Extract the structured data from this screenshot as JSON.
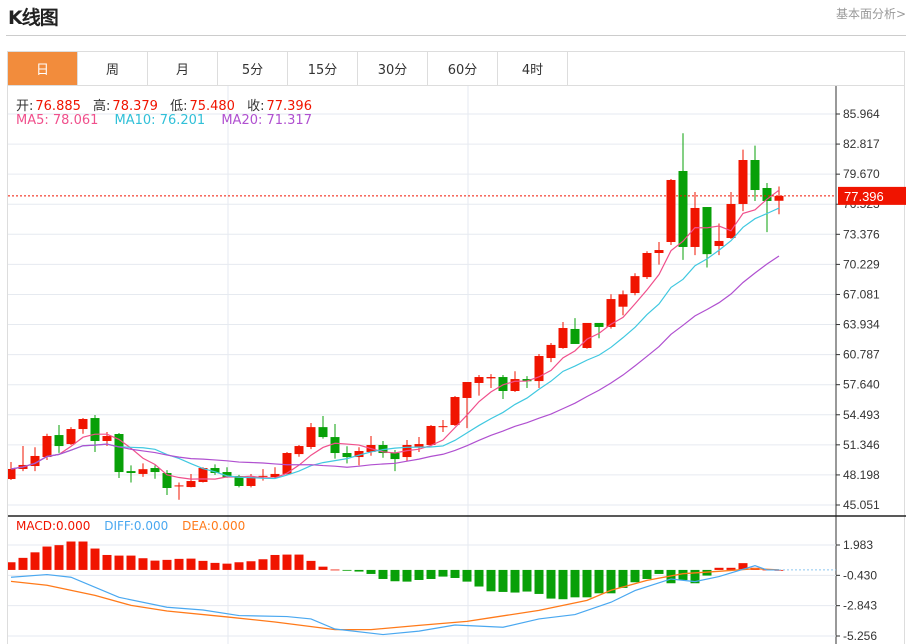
{
  "header": {
    "title": "K线图",
    "fundamental_link": "基本面分析>"
  },
  "tabs": [
    {
      "label": "日",
      "active": true
    },
    {
      "label": "周"
    },
    {
      "label": "月"
    },
    {
      "label": "5分"
    },
    {
      "label": "15分"
    },
    {
      "label": "30分"
    },
    {
      "label": "60分"
    },
    {
      "label": "4时"
    }
  ],
  "ohlc_legend": {
    "open_label": "开:",
    "open": "76.885",
    "high_label": "高:",
    "high": "78.379",
    "low_label": "低:",
    "low": "75.480",
    "close_label": "收:",
    "close": "77.396"
  },
  "ma_legend": {
    "ma5": "MA5: 78.061",
    "ma10": "MA10: 76.201",
    "ma20": "MA20: 71.317"
  },
  "macd_legend": {
    "macd": "MACD:0.000",
    "diff": "DIFF:0.000",
    "dea": "DEA:0.000"
  },
  "colors": {
    "up": "#f01400",
    "down": "#08a008",
    "ma5": "#f0508c",
    "ma10": "#40c8e0",
    "ma20": "#b050d0",
    "diff": "#4aa8f0",
    "dea": "#ff7a1a",
    "accent": "#f28c3c"
  },
  "chart_data": [
    {
      "type": "candlestick",
      "title": "",
      "price_axis_ticks": [
        "85.964",
        "82.817",
        "79.670",
        "76.523",
        "73.376",
        "70.229",
        "67.081",
        "63.934",
        "60.787",
        "57.640",
        "54.493",
        "51.346",
        "48.198",
        "45.051"
      ],
      "ylim": [
        45.051,
        85.964
      ],
      "current_price": "77.396",
      "grid": true,
      "ohlc": [
        [
          47.77,
          49.55,
          47.67,
          48.82
        ],
        [
          48.82,
          51.22,
          48.6,
          49.24
        ],
        [
          49.13,
          51.1,
          48.6,
          50.18
        ],
        [
          50.07,
          52.5,
          49.76,
          52.27
        ],
        [
          52.37,
          53.42,
          50.5,
          51.22
        ],
        [
          51.43,
          53.2,
          51.33,
          53.0
        ],
        [
          53.0,
          54.15,
          52.5,
          54.05
        ],
        [
          54.15,
          54.47,
          50.6,
          51.75
        ],
        [
          51.75,
          52.69,
          51.22,
          52.27
        ],
        [
          52.48,
          52.58,
          47.87,
          48.5
        ],
        [
          48.6,
          49.2,
          47.4,
          48.4
        ],
        [
          48.3,
          49.4,
          48.0,
          48.8
        ],
        [
          48.92,
          49.2,
          47.8,
          48.5
        ],
        [
          48.4,
          48.7,
          46.1,
          46.83
        ],
        [
          47.0,
          47.4,
          45.6,
          47.1
        ],
        [
          46.93,
          48.3,
          46.9,
          47.56
        ],
        [
          47.46,
          49.0,
          47.4,
          48.92
        ],
        [
          48.92,
          49.3,
          48.2,
          48.4
        ],
        [
          48.5,
          49.0,
          47.9,
          47.98
        ],
        [
          48.08,
          48.2,
          46.9,
          47.04
        ],
        [
          47.04,
          48.3,
          46.9,
          47.98
        ],
        [
          48.0,
          48.8,
          47.6,
          48.1
        ],
        [
          47.98,
          49.0,
          47.9,
          48.3
        ],
        [
          48.3,
          50.6,
          48.2,
          50.49
        ],
        [
          50.38,
          51.33,
          50.1,
          51.22
        ],
        [
          51.12,
          53.63,
          50.9,
          53.2
        ],
        [
          53.2,
          54.36,
          52.0,
          52.16
        ],
        [
          52.16,
          53.53,
          49.9,
          50.49
        ],
        [
          50.49,
          51.2,
          49.4,
          50.07
        ],
        [
          50.07,
          51.1,
          49.2,
          50.7
        ],
        [
          50.6,
          52.27,
          50.2,
          51.33
        ],
        [
          51.33,
          51.75,
          50.0,
          50.49
        ],
        [
          50.49,
          50.8,
          48.6,
          49.86
        ],
        [
          50.07,
          51.85,
          49.6,
          51.33
        ],
        [
          51.12,
          52.16,
          50.6,
          51.43
        ],
        [
          51.33,
          53.42,
          51.2,
          53.32
        ],
        [
          53.2,
          53.95,
          52.69,
          53.3
        ],
        [
          53.42,
          56.46,
          53.32,
          56.35
        ],
        [
          56.25,
          57.4,
          53.1,
          57.92
        ],
        [
          57.82,
          58.65,
          56.5,
          58.44
        ],
        [
          58.3,
          58.75,
          57.3,
          58.44
        ],
        [
          58.44,
          58.65,
          56.14,
          56.98
        ],
        [
          56.98,
          59.05,
          56.88,
          58.23
        ],
        [
          58.23,
          58.54,
          57.3,
          58.0
        ],
        [
          58.02,
          60.85,
          57.3,
          60.64
        ],
        [
          60.43,
          62.0,
          60.0,
          61.8
        ],
        [
          61.48,
          64.2,
          61.4,
          63.57
        ],
        [
          63.47,
          64.6,
          62.4,
          61.9
        ],
        [
          61.48,
          64.1,
          61.4,
          64.1
        ],
        [
          64.1,
          64.1,
          62.5,
          63.68
        ],
        [
          63.68,
          67.1,
          63.5,
          66.6
        ],
        [
          65.8,
          67.5,
          64.9,
          67.1
        ],
        [
          67.23,
          69.3,
          67.0,
          69.0
        ],
        [
          68.9,
          71.6,
          68.7,
          71.42
        ],
        [
          71.42,
          72.57,
          70.2,
          71.73
        ],
        [
          72.57,
          79.16,
          72.26,
          79.06
        ],
        [
          80.0,
          83.95,
          70.7,
          72.05
        ],
        [
          72.05,
          77.8,
          71.2,
          76.13
        ],
        [
          76.23,
          76.23,
          69.9,
          71.3
        ],
        [
          72.15,
          74.5,
          71.2,
          72.68
        ],
        [
          72.99,
          77.8,
          72.9,
          76.55
        ],
        [
          76.55,
          82.23,
          75.8,
          81.15
        ],
        [
          81.15,
          82.65,
          76.86,
          78.01
        ],
        [
          78.22,
          78.75,
          73.6,
          76.86
        ],
        [
          76.885,
          78.379,
          75.48,
          77.396
        ]
      ],
      "moving_averages": [
        "MA5",
        "MA10",
        "MA20"
      ]
    },
    {
      "type": "macd",
      "ticks": [
        "1.983",
        "-0.430",
        "-2.843",
        "-5.256"
      ],
      "ylim": [
        -5.6,
        2.6
      ],
      "histogram": [
        0.61,
        0.96,
        1.4,
        1.86,
        1.97,
        2.26,
        2.26,
        1.7,
        1.19,
        1.14,
        1.14,
        0.93,
        0.74,
        0.8,
        0.88,
        0.9,
        0.72,
        0.56,
        0.5,
        0.61,
        0.69,
        0.85,
        1.19,
        1.22,
        1.22,
        0.72,
        0.26,
        0.03,
        -0.03,
        -0.13,
        -0.32,
        -0.72,
        -0.9,
        -0.93,
        -0.8,
        -0.72,
        -0.53,
        -0.64,
        -0.93,
        -1.32,
        -1.7,
        -1.75,
        -1.8,
        -1.72,
        -1.91,
        -2.28,
        -2.33,
        -2.18,
        -2.18,
        -1.86,
        -1.86,
        -1.43,
        -0.98,
        -0.72,
        -0.32,
        -1.06,
        -0.8,
        -1.06,
        -0.45,
        0.17,
        0.17,
        0.54,
        0.17,
        0.03,
        0.0
      ],
      "diff": [
        [
          0,
          -0.58
        ],
        [
          3,
          -0.37
        ],
        [
          5,
          -0.58
        ],
        [
          9,
          -2.18
        ],
        [
          13,
          -2.97
        ],
        [
          16,
          -3.19
        ],
        [
          19,
          -3.63
        ],
        [
          23,
          -3.71
        ],
        [
          25,
          -3.9
        ],
        [
          27,
          -4.7
        ],
        [
          31,
          -5.14
        ],
        [
          34,
          -4.87
        ],
        [
          37,
          -4.38
        ],
        [
          41,
          -4.56
        ],
        [
          44,
          -3.9
        ],
        [
          47,
          -3.55
        ],
        [
          50,
          -2.57
        ],
        [
          52,
          -1.64
        ],
        [
          55,
          -0.72
        ],
        [
          57,
          -0.93
        ],
        [
          59,
          -0.53
        ],
        [
          62,
          0.34
        ],
        [
          63,
          0.0
        ],
        [
          64,
          0.0
        ]
      ],
      "dea": [
        [
          0,
          -0.91
        ],
        [
          3,
          -1.22
        ],
        [
          7,
          -2.02
        ],
        [
          10,
          -2.82
        ],
        [
          13,
          -3.27
        ],
        [
          18,
          -3.74
        ],
        [
          22,
          -4.14
        ],
        [
          27,
          -4.75
        ],
        [
          30,
          -4.75
        ],
        [
          34,
          -4.41
        ],
        [
          38,
          -4.09
        ],
        [
          40,
          -3.8
        ],
        [
          44,
          -3.22
        ],
        [
          48,
          -2.42
        ],
        [
          50,
          -1.62
        ],
        [
          53,
          -0.83
        ],
        [
          56,
          -0.3
        ],
        [
          59,
          -0.11
        ],
        [
          62,
          0.1
        ],
        [
          64,
          0.0
        ]
      ]
    }
  ]
}
